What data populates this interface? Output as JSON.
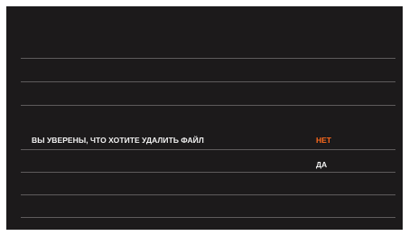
{
  "dialog": {
    "question": "ВЫ УВЕРЕНЫ, ЧТО ХОТИТЕ УДАЛИТЬ ФАЙЛ",
    "options": [
      {
        "label": "НЕТ",
        "selected": true
      },
      {
        "label": "ДА",
        "selected": false
      }
    ]
  },
  "colors": {
    "background": "#1c1a1b",
    "text": "#f2f2f2",
    "selected": "#ff6a1c",
    "divider": "#5e5b5c"
  }
}
